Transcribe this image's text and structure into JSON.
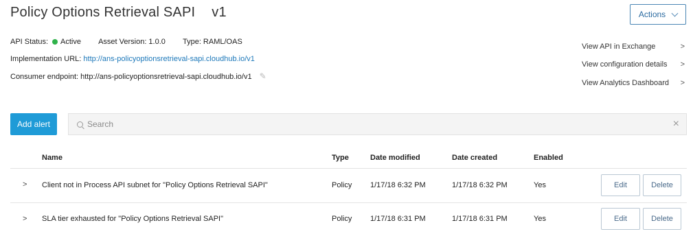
{
  "header": {
    "title": "Policy Options Retrieval SAPI",
    "version": "v1",
    "actions_label": "Actions"
  },
  "meta": {
    "status_label": "API Status:",
    "status_value": "Active",
    "status_color": "#2fb24a",
    "asset_version": "Asset Version: 1.0.0",
    "type": "Type: RAML/OAS",
    "impl_label": "Implementation URL:",
    "impl_url": "http://ans-policyoptionsretrieval-sapi.cloudhub.io/v1",
    "consumer_label": "Consumer endpoint:",
    "consumer_url": "http://ans-policyoptionsretrieval-sapi.cloudhub.io/v1"
  },
  "side_links": [
    {
      "label": "View API in Exchange",
      "chevron": ">"
    },
    {
      "label": "View configuration details",
      "chevron": ">"
    },
    {
      "label": "View Analytics Dashboard",
      "chevron": ">"
    }
  ],
  "toolbar": {
    "add_alert_label": "Add alert",
    "search_placeholder": "Search",
    "accent_color": "#1f9bd7"
  },
  "table": {
    "columns": [
      "Name",
      "Type",
      "Date modified",
      "Date created",
      "Enabled"
    ],
    "rows": [
      {
        "expander": ">",
        "name": "Client not in Process API subnet for \"Policy Options Retrieval SAPI\"",
        "type": "Policy",
        "modified": "1/17/18 6:32 PM",
        "created": "1/17/18 6:32 PM",
        "enabled": "Yes",
        "edit": "Edit",
        "delete": "Delete"
      },
      {
        "expander": ">",
        "name": "SLA tier exhausted for \"Policy Options Retrieval SAPI\"",
        "type": "Policy",
        "modified": "1/17/18 6:31 PM",
        "created": "1/17/18 6:31 PM",
        "enabled": "Yes",
        "edit": "Edit",
        "delete": "Delete"
      }
    ]
  }
}
